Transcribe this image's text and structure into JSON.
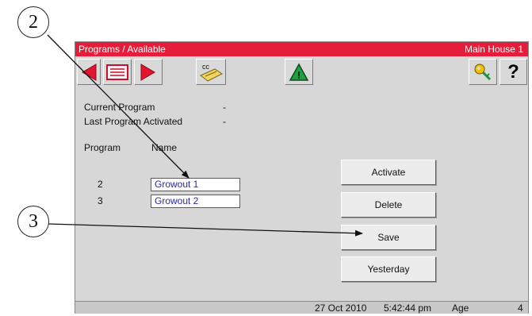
{
  "window": {
    "title": "Programs / Available",
    "house": "Main House 1"
  },
  "toolbar": {
    "prev_icon": "left-arrow-red",
    "list_icon": "list-icon",
    "next_icon": "right-arrow-red",
    "cc_icon": "cc-document-icon",
    "cc_label": "cc",
    "alarm_icon": "warning-triangle-icon",
    "alarm_label": "!",
    "key_icon": "key-icon",
    "help_label": "?"
  },
  "info": {
    "current_program_label": "Current Program",
    "current_program_value": "-",
    "last_activated_label": "Last Program Activated",
    "last_activated_value": "-"
  },
  "table": {
    "headers": [
      "Program",
      "Name"
    ],
    "rows": [
      {
        "program": "2",
        "name": "Growout 1"
      },
      {
        "program": "3",
        "name": "Growout 2"
      }
    ]
  },
  "actions": {
    "activate": "Activate",
    "delete": "Delete",
    "save": "Save",
    "yesterday": "Yesterday"
  },
  "status": {
    "date": "27 Oct 2010",
    "time": "5:42:44 pm",
    "age_label": "Age",
    "age_value": "4"
  },
  "callouts": {
    "c2": "2",
    "c3": "3"
  },
  "colors": {
    "titlebar": "#e41e3a",
    "screen_bg": "#d7d7d7",
    "input_text": "#2a2aa0"
  }
}
